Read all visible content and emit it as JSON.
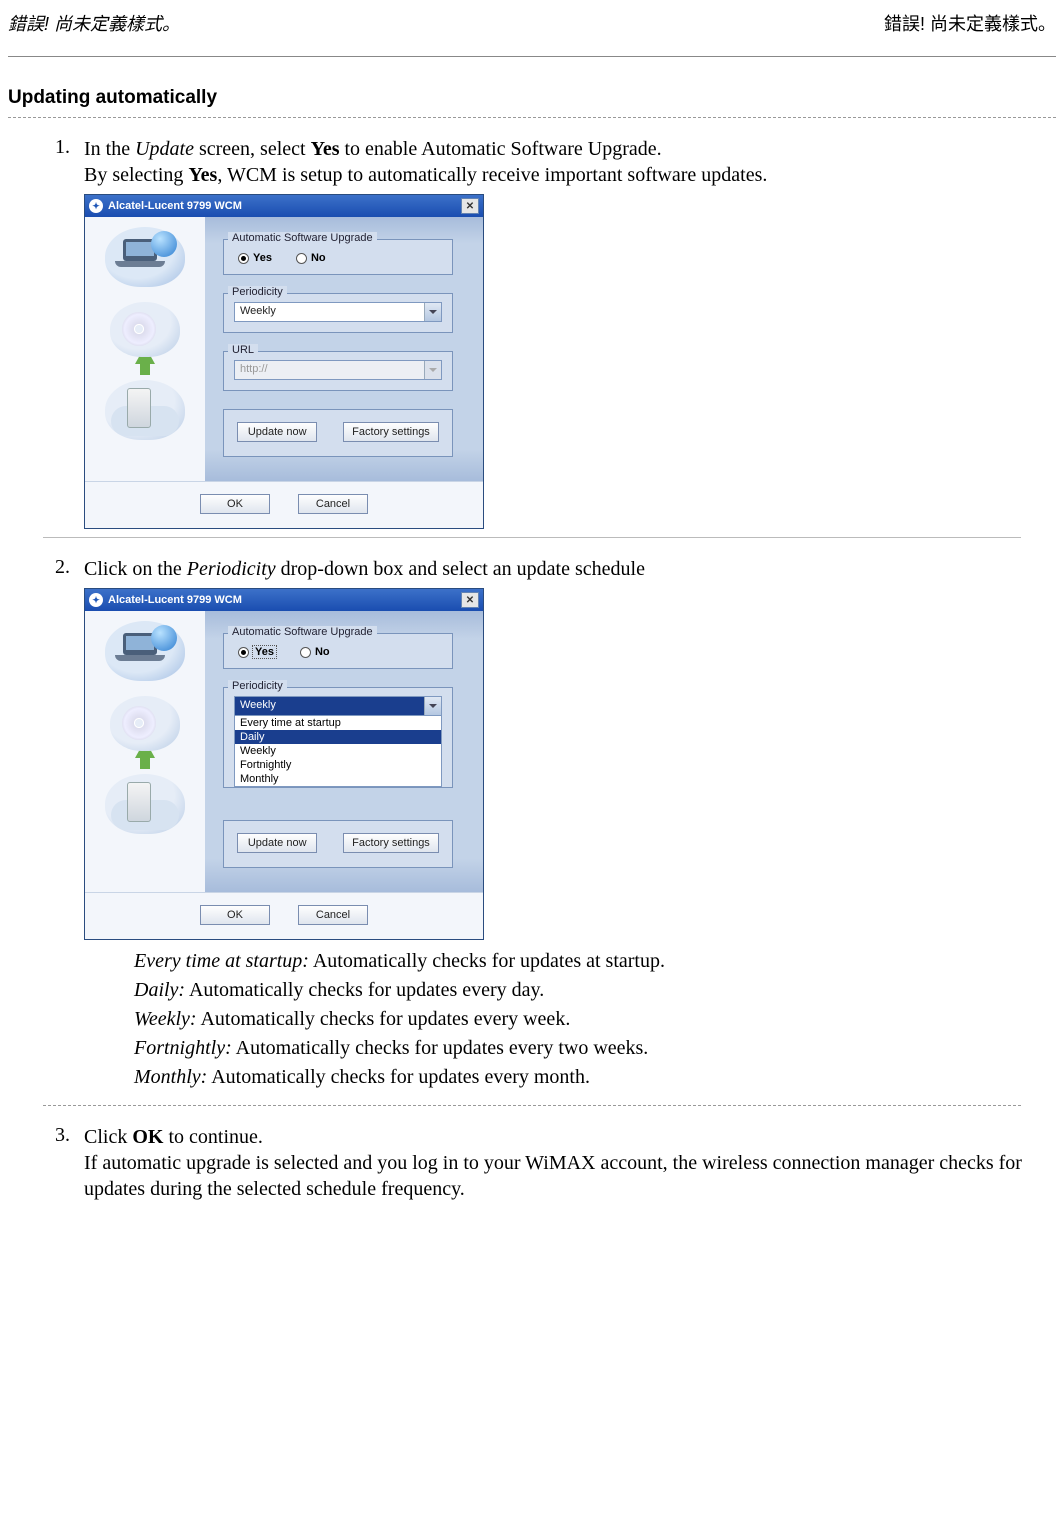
{
  "header_left": "錯誤! 尚未定義樣式。",
  "header_right": "錯誤! 尚未定義樣式。",
  "section_title": "Updating automatically",
  "steps": {
    "s1": {
      "num": "1.",
      "part1": "In the ",
      "italic1": "Update",
      "part2": " screen, select ",
      "bold1": "Yes",
      "part3": " to enable Automatic Software Upgrade.",
      "line2a": "By selecting ",
      "line2bold": "Yes",
      "line2b": ", WCM is setup to automatically receive important software updates."
    },
    "s2": {
      "num": "2.",
      "part1": "Click on the ",
      "italic1": "Periodicity",
      "part2": " drop-down box and select an update schedule"
    },
    "s3": {
      "num": "3.",
      "part1": "Click ",
      "bold1": "OK",
      "part2": " to continue.",
      "line2": "If automatic upgrade is selected and you log in to your WiMAX account, the wireless connection manager checks for updates during the selected schedule frequency."
    }
  },
  "dialog": {
    "title": "Alcatel-Lucent 9799 WCM",
    "close": "✕",
    "autoUpgradeLabel": "Automatic Software Upgrade",
    "yes": "Yes",
    "no": "No",
    "periodicityLabel": "Periodicity",
    "periodicityValue": "Weekly",
    "urlLabel": "URL",
    "urlValue": "http://",
    "updateNow": "Update now",
    "factory": "Factory settings",
    "ok": "OK",
    "cancel": "Cancel",
    "options": {
      "o0": "Every time at startup",
      "o1": "Daily",
      "o2": "Weekly",
      "o3": "Fortnightly",
      "o4": "Monthly"
    }
  },
  "desc": {
    "d0": {
      "it": "Every time at startup:",
      "txt": " Automatically checks for updates at startup."
    },
    "d1": {
      "it": "Daily:",
      "txt": " Automatically checks for updates every day."
    },
    "d2": {
      "it": "Weekly:",
      "txt": " Automatically checks for updates every week."
    },
    "d3": {
      "it": "Fortnightly:",
      "txt": " Automatically checks for updates every two weeks."
    },
    "d4": {
      "it": "Monthly:",
      "txt": " Automatically checks for updates every month."
    }
  }
}
